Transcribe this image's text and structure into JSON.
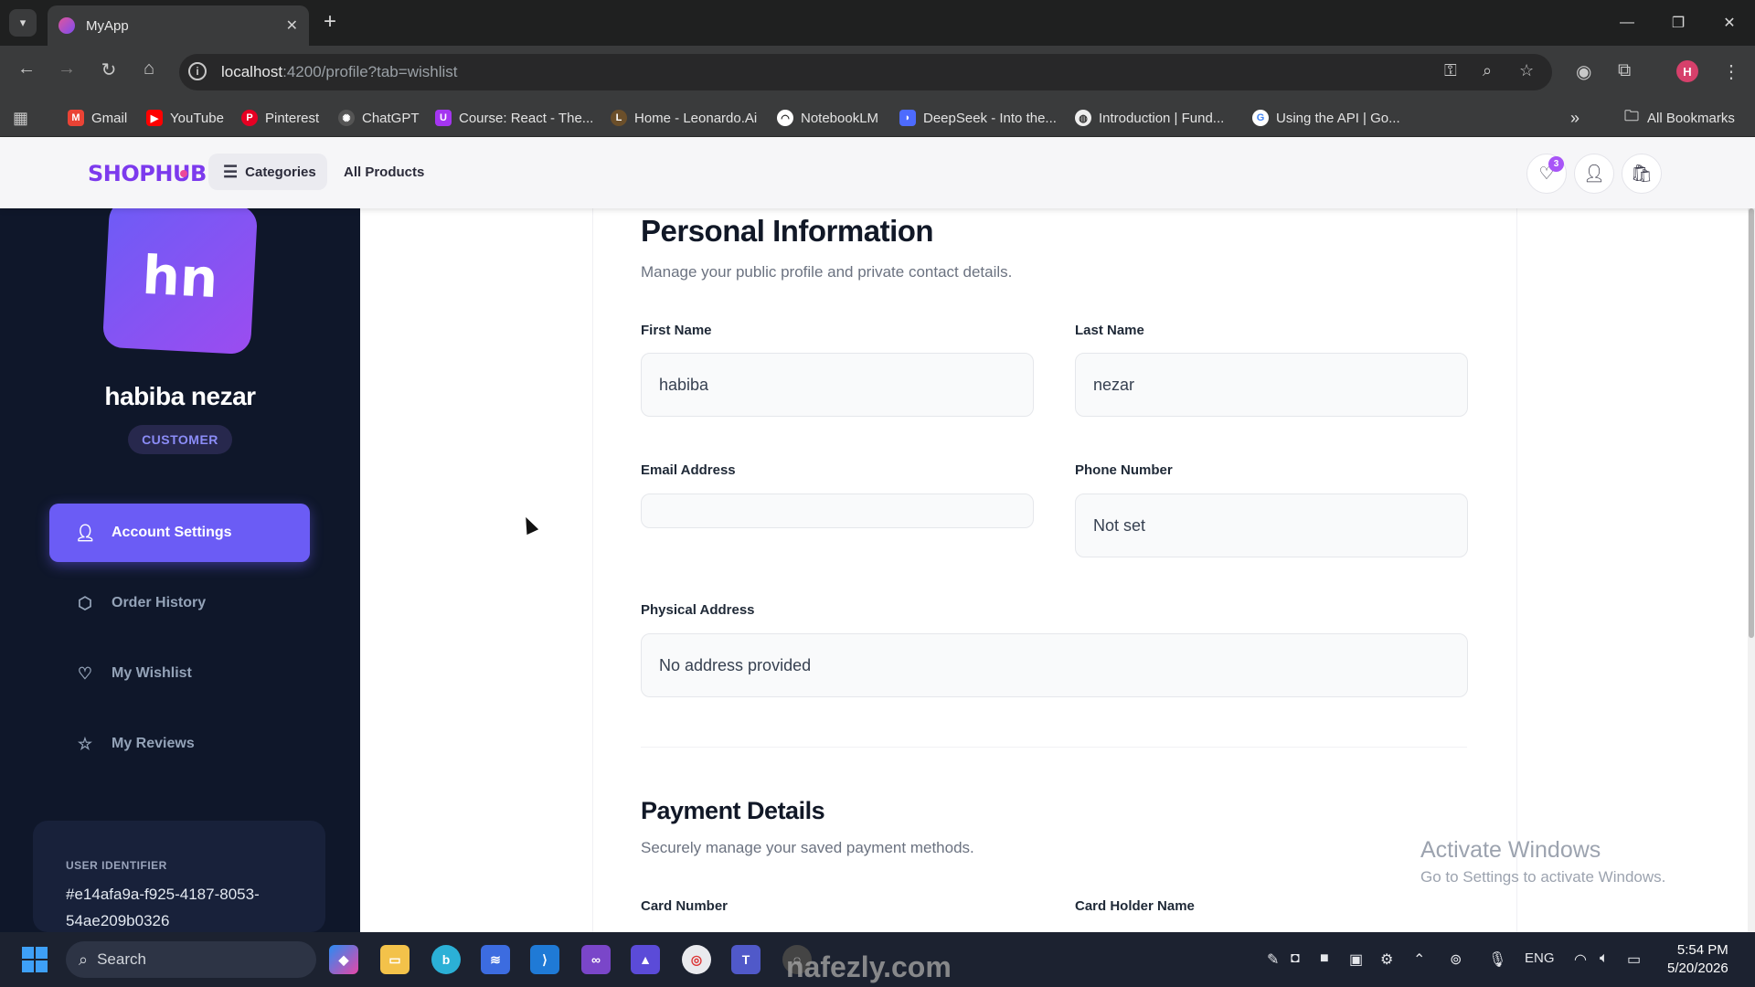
{
  "browser": {
    "tab_title": "MyApp",
    "url_host": "localhost",
    "url_rest": ":4200/profile?tab=wishlist",
    "bookmarks": [
      {
        "label": "Gmail",
        "color": "#ea4335"
      },
      {
        "label": "YouTube",
        "color": "#ff0000"
      },
      {
        "label": "Pinterest",
        "color": "#e60023"
      },
      {
        "label": "ChatGPT",
        "color": "#444444"
      },
      {
        "label": "Course: React - The...",
        "color": "#a435f0"
      },
      {
        "label": "Home - Leonardo.Ai",
        "color": "#6b4f2a"
      },
      {
        "label": "NotebookLM",
        "color": "#222222"
      },
      {
        "label": "DeepSeek - Into the...",
        "color": "#4d6bfe"
      },
      {
        "label": "Introduction | Fund...",
        "color": "#333333"
      },
      {
        "label": "Using the API | Go...",
        "color": "#4285f4"
      }
    ],
    "all_bookmarks": "All Bookmarks",
    "profile_initial": "H"
  },
  "header": {
    "logo": "SHOPHUB",
    "categories": "Categories",
    "all_products": "All Products",
    "wishlist_count": "3"
  },
  "sidebar": {
    "avatar_initials": "hn",
    "user_name": "habiba nezar",
    "role": "CUSTOMER",
    "items": [
      {
        "label": "Account Settings",
        "icon": "user-icon",
        "active": true
      },
      {
        "label": "Order History",
        "icon": "box-icon",
        "active": false
      },
      {
        "label": "My Wishlist",
        "icon": "heart-icon",
        "active": false
      },
      {
        "label": "My Reviews",
        "icon": "star-icon",
        "active": false
      }
    ],
    "uid_label": "USER IDENTIFIER",
    "uid_value": "#e14afa9a-f925-4187-8053-54ae209b0326"
  },
  "personal": {
    "title": "Personal Information",
    "subtitle": "Manage your public profile and private contact details.",
    "first_name_label": "First Name",
    "first_name": "habiba",
    "last_name_label": "Last Name",
    "last_name": "nezar",
    "email_label": "Email Address",
    "email": "",
    "phone_label": "Phone Number",
    "phone": "Not set",
    "address_label": "Physical Address",
    "address": "No address provided"
  },
  "payment": {
    "title": "Payment Details",
    "subtitle": "Securely manage your saved payment methods.",
    "card_number_label": "Card Number",
    "card_holder_label": "Card Holder Name"
  },
  "os": {
    "activate_title": "Activate Windows",
    "activate_sub": "Go to Settings to activate Windows.",
    "watermark": "nafezly.com",
    "search_label": "Search",
    "lang": "ENG",
    "time": "5:54 PM",
    "date": "5/20/2026"
  },
  "colors": {
    "accent": "#6b5cf5",
    "sidebar_bg": "#0f172a",
    "logo": "#7c3aed"
  }
}
